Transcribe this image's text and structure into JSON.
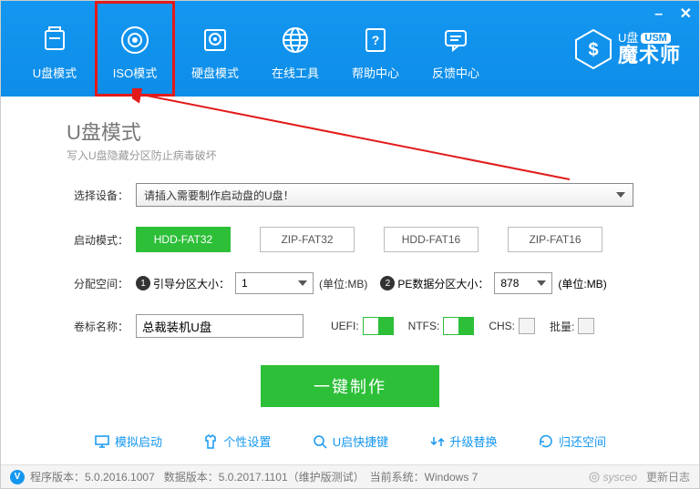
{
  "header": {
    "tabs": [
      {
        "label": "U盘模式"
      },
      {
        "label": "ISO模式"
      },
      {
        "label": "硬盘模式"
      },
      {
        "label": "在线工具"
      },
      {
        "label": "帮助中心"
      },
      {
        "label": "反馈中心"
      }
    ]
  },
  "logo": {
    "line1": "U盘",
    "usm": "USM",
    "line2": "魔术师"
  },
  "page": {
    "title": "U盘模式",
    "subtitle": "写入U盘隐藏分区防止病毒破坏"
  },
  "labels": {
    "device": "选择设备：",
    "boot_mode": "启动模式：",
    "alloc": "分配空间：",
    "volume": "卷标名称："
  },
  "device": {
    "placeholder": "请插入需要制作启动盘的U盘！"
  },
  "boot_modes": {
    "m1": "HDD-FAT32",
    "m2": "ZIP-FAT32",
    "m3": "HDD-FAT16",
    "m4": "ZIP-FAT16"
  },
  "alloc": {
    "part1_label": "引导分区大小：",
    "part1_value": "1",
    "unit1": "(单位:MB)",
    "part2_label": "PE数据分区大小：",
    "part2_value": "878",
    "unit2": "(单位:MB)",
    "circ1": "1",
    "circ2": "2"
  },
  "volume": {
    "value": "总裁装机U盘",
    "uefi": "UEFI:",
    "ntfs": "NTFS:",
    "chs": "CHS:",
    "batch": "批量:"
  },
  "main_button": "一键制作",
  "footer_links": {
    "l1": "模拟启动",
    "l2": "个性设置",
    "l3": "U启快捷键",
    "l4": "升级替换",
    "l5": "归还空间"
  },
  "status": {
    "v": "V",
    "program_ver_label": "程序版本：",
    "program_ver": "5.0.2016.1007",
    "data_ver_label": "数据版本：",
    "data_ver": "5.0.2017.1101（维护版测试）",
    "os_label": "当前系统：",
    "os": "Windows 7",
    "brand": "sysceo",
    "update": "更新日志"
  }
}
